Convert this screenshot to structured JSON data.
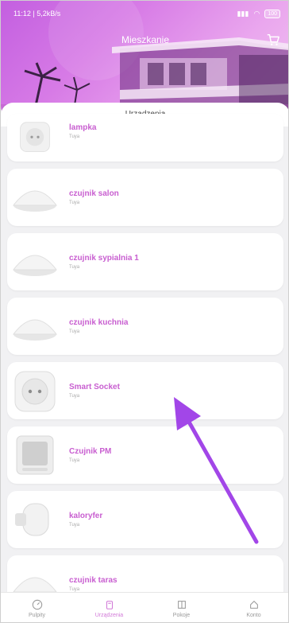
{
  "status": {
    "time": "11:12 | 5,2kB/s",
    "battery": "100"
  },
  "header": {
    "title": "Mieszkanie"
  },
  "section": {
    "title": "Urządzenia"
  },
  "devices": [
    {
      "name": "lampka",
      "brand": "Tuya",
      "icon": "smart-plug"
    },
    {
      "name": "czujnik salon",
      "brand": "Tuya",
      "icon": "sensor-dome"
    },
    {
      "name": "czujnik sypialnia 1",
      "brand": "Tuya",
      "icon": "sensor-dome"
    },
    {
      "name": "czujnik kuchnia",
      "brand": "Tuya",
      "icon": "sensor-dome"
    },
    {
      "name": "Smart Socket",
      "brand": "Tuya",
      "icon": "smart-plug"
    },
    {
      "name": "Czujnik PM",
      "brand": "Tuya",
      "icon": "air-sensor"
    },
    {
      "name": "kaloryfer",
      "brand": "Tuya",
      "icon": "radiator-valve"
    },
    {
      "name": "czujnik taras",
      "brand": "Tuya",
      "icon": "sensor-dome"
    }
  ],
  "nav": [
    {
      "label": "Pulpity",
      "icon": "gauge-icon"
    },
    {
      "label": "Urządzenia",
      "icon": "device-icon"
    },
    {
      "label": "Pokoje",
      "icon": "rooms-icon"
    },
    {
      "label": "Konto",
      "icon": "home-icon"
    }
  ],
  "colors": {
    "accent": "#c85ed0",
    "header_start": "#c35fe0",
    "arrow": "#a246e8"
  }
}
